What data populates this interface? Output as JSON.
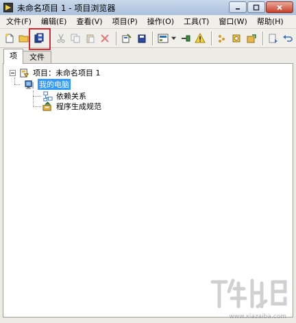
{
  "window": {
    "title": "未命名项目 1 - 项目浏览器"
  },
  "menubar": {
    "items": [
      {
        "label": "文件(F)"
      },
      {
        "label": "编辑(E)"
      },
      {
        "label": "查看(V)"
      },
      {
        "label": "项目(P)"
      },
      {
        "label": "操作(O)"
      },
      {
        "label": "工具(T)"
      },
      {
        "label": "窗口(W)"
      },
      {
        "label": "帮助(H)"
      }
    ]
  },
  "toolbar": {
    "icons": [
      "new-icon",
      "open-icon",
      "save-all-icon",
      "cut-icon",
      "copy-icon",
      "paste-icon",
      "delete-icon",
      "build-icon",
      "deploy-icon",
      "view-icon",
      "connect-icon",
      "warning-icon",
      "filter-icon",
      "settings-icon",
      "export-icon",
      "step-icon",
      "undo-icon"
    ],
    "highlight_color": "#d8262e"
  },
  "tabs": [
    {
      "label": "项",
      "active": true
    },
    {
      "label": "文件",
      "active": false
    }
  ],
  "tree": {
    "root": {
      "label": "项目：未命名项目 1"
    },
    "computer": {
      "label": "我的电脑",
      "selected": true
    },
    "children": [
      {
        "label": "依赖关系"
      },
      {
        "label": "程序生成规范"
      }
    ]
  },
  "colors": {
    "selection": "#3399ff",
    "panel_bg": "#ffffff",
    "chrome_bg": "#f0efea"
  }
}
